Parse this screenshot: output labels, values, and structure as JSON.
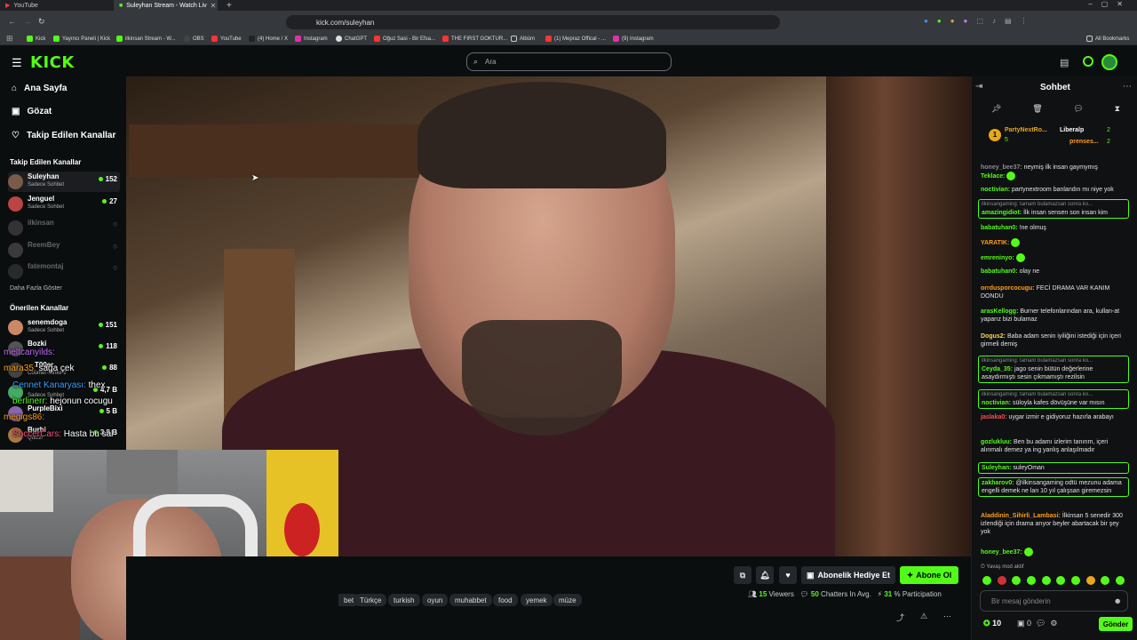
{
  "browser": {
    "tabs": [
      {
        "label": "YouTube",
        "active": false
      },
      {
        "label": "Suleyhan Stream - Watch Liv",
        "active": true
      }
    ],
    "url": "kick.com/suleyhan",
    "bookmarks": [
      "Kick",
      "Yayıncı Paneli | Kick",
      "ilkinsan Stream - W...",
      "OBS",
      "YouTube",
      "(4) Home / X",
      "Instagram",
      "ChatGPT",
      "Oğuz Sasi - Bir Efsa...",
      "THE FIRST GOKTUR...",
      "Albüm",
      "(1) Mepraz Offical - ...",
      "(9) Instagram"
    ],
    "all_bookmarks": "All Bookmarks"
  },
  "header": {
    "logo": "KICK",
    "search_placeholder": "Ara"
  },
  "sidebar": {
    "nav": [
      {
        "label": "Ana Sayfa",
        "icon": "home-icon"
      },
      {
        "label": "Gözat",
        "icon": "browse-icon"
      },
      {
        "label": "Takip Edilen Kanallar",
        "icon": "heart-icon"
      }
    ],
    "followed_heading": "Takip Edilen Kanallar",
    "followed": [
      {
        "name": "Suleyhan",
        "sub": "Sadece Sohbet",
        "count": "152",
        "online": true
      },
      {
        "name": "Jenguel",
        "sub": "Sadece Sohbet",
        "count": "27",
        "online": true
      },
      {
        "name": "ilkinsan",
        "sub": "",
        "count": "",
        "online": false
      },
      {
        "name": "ReemBey",
        "sub": "",
        "count": "",
        "online": false
      },
      {
        "name": "fatemontaj",
        "sub": "",
        "count": "",
        "online": false
      }
    ],
    "show_more": "Daha Fazla Göster",
    "recommended_heading": "Önerilen Kanallar",
    "recommended": [
      {
        "name": "senemdoga",
        "sub": "Sadece Sohbet",
        "count": "151"
      },
      {
        "name": "Bozki",
        "sub": "",
        "count": "118"
      },
      {
        "name": "T00er",
        "sub": "Counter-Strike 2",
        "count": "88"
      },
      {
        "name": "",
        "sub": "Sadece Sohbet",
        "count": "4,7 B"
      },
      {
        "name": "PurpleBixi",
        "sub": "",
        "count": "5 B"
      },
      {
        "name": "Burhi",
        "sub": "Quizzi",
        "count": "3,8 B"
      }
    ]
  },
  "stream_overlay_chat": [
    {
      "user": "meltcanyilds:",
      "text": ""
    },
    {
      "user": "mara35:",
      "text": "sağa çek"
    },
    {
      "user": "Cennet Kanaryası:",
      "text": "thex"
    },
    {
      "user": "berlinerr:",
      "text": "hejonun cocugu"
    },
    {
      "user": "megigs86:",
      "text": ""
    },
    {
      "user": "SoccerCars:",
      "text": "Hasta bu sal"
    }
  ],
  "bottom": {
    "tags": [
      "bet",
      "Türkçe",
      "turkish",
      "oyun",
      "muhabbet",
      "food",
      "yemek",
      "müze"
    ],
    "gift_sub_label": "Abonelik Hediye Et",
    "subscribe_label": "Abone Ol",
    "viewers": "15",
    "viewers_label": "Viewers",
    "chatters": "50",
    "chatters_label": "Chatters In Avg.",
    "participation": "31",
    "participation_label": "% Participation"
  },
  "chat": {
    "title": "Sohbet",
    "pinned": [
      {
        "name": "PartyNextRo...",
        "count": "5"
      },
      {
        "name": "Liberalp",
        "count": "2"
      },
      {
        "name": "prenses...",
        "count": "2"
      }
    ],
    "messages": [
      {
        "user": "honey_bee37:",
        "text": "neymiş ilk insan gaymymış",
        "color": "#8a8d90",
        "boxed": false,
        "reply": ""
      },
      {
        "user": "Teklace:",
        "text": "",
        "color": "#53fc18",
        "boxed": false,
        "reply": ""
      },
      {
        "user": "noctivian:",
        "text": "partynextroom banlandın mı niye yok",
        "color": "#53fc18",
        "boxed": false,
        "reply": ""
      },
      {
        "user": "amazingidiot:",
        "text": "İlk insan sensen son insan kim",
        "color": "#53fc18",
        "boxed": true,
        "reply": "ilkinsangaming: tamam bulamazsan sonra ko..."
      },
      {
        "user": "babatuhan0:",
        "text": "!ne olmuş",
        "color": "#53fc18",
        "boxed": false,
        "reply": ""
      },
      {
        "user": "YARATIK:",
        "text": "",
        "color": "#ff9f1c",
        "boxed": false,
        "reply": ""
      },
      {
        "user": "emreninyo:",
        "text": "",
        "color": "#53fc18",
        "boxed": false,
        "reply": ""
      },
      {
        "user": "babatuhan0:",
        "text": "olay ne",
        "color": "#53fc18",
        "boxed": false,
        "reply": ""
      },
      {
        "user": "orrdusporcocugu:",
        "text": "FECİ DRAMA VAR KANIM DONDU",
        "color": "#ff9f1c",
        "boxed": false,
        "reply": ""
      },
      {
        "user": "arasKellogg:",
        "text": "Burner telefonlarından ara, kullan-at yaparız bizi bulamaz",
        "color": "#53fc18",
        "boxed": false,
        "reply": ""
      },
      {
        "user": "Dogus2:",
        "text": "Baba adam senin iyiliğini istediği için içeri girmeli demiş",
        "color": "#ffd54a",
        "boxed": false,
        "reply": ""
      },
      {
        "user": "Ceyda_35:",
        "text": "jago senin bütün değerlerine asaydırmıştı sesin çıkmamıştı rezilsin",
        "color": "#53fc18",
        "boxed": true,
        "reply": "ilkinsangaming: tamam bulamazsan sonra ko..."
      },
      {
        "user": "noctivian:",
        "text": "süloyla kafes dövüşüne var mısın",
        "color": "#53fc18",
        "boxed": true,
        "reply": "ilkinsangaming: tamam bulamazsan sonra ko..."
      },
      {
        "user": "jaslaka0:",
        "text": "uygar izmir e gidiyoruz hazırla arabayı",
        "color": "#ff4f4f",
        "boxed": false,
        "reply": ""
      },
      {
        "user": "gozlukluu:",
        "text": "Ben bu adamı izlerim tanırım, içeri alınmalı demez ya ing yanlış anlaşılmadır",
        "color": "#53fc18",
        "boxed": false,
        "reply": ""
      },
      {
        "user": "Suleyhan:",
        "text": "suleyOman",
        "color": "#53fc18",
        "boxed": true,
        "reply": ""
      },
      {
        "user": "zakharov0:",
        "text": "@ilkinsangaming odtü mezunu adama engelli demek ne lan 10 yıl çalışsan giremezsin",
        "color": "#53fc18",
        "boxed": true,
        "reply": ""
      },
      {
        "user": "Aladdinin_Sihirli_Lambasi:",
        "text": "İlkinsan 5 senedir 300 izlendiği için drama arıyor beyler abartacak bir şey yok",
        "color": "#ff9f1c",
        "boxed": false,
        "reply": ""
      },
      {
        "user": "honey_bee37:",
        "text": "",
        "color": "#53fc18",
        "boxed": false,
        "reply": ""
      }
    ],
    "slow_mode": "Yavaş mod aktif",
    "input_placeholder": "Bir mesaj gönderin",
    "points": "10",
    "send_label": "Gönder"
  },
  "colors": {
    "accent": "#53fc18",
    "background": "#0b0e0f"
  }
}
